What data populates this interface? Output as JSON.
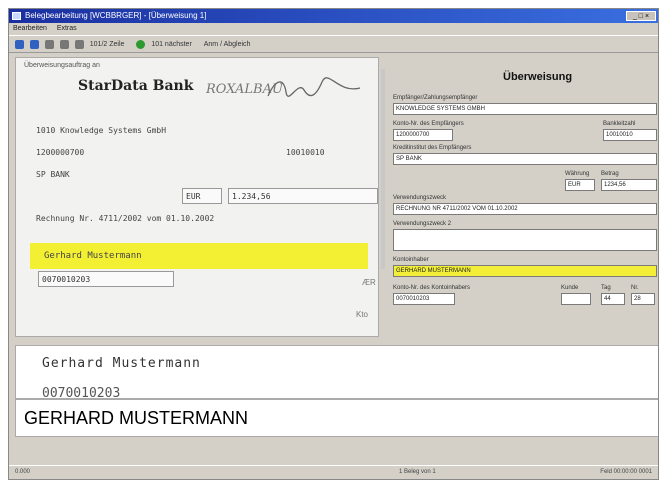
{
  "window": {
    "title": "Belegbearbeitung [WCBBRGER] - [Überweisung 1]"
  },
  "menu": {
    "items": [
      "Bearbeiten",
      "Extras"
    ]
  },
  "toolbar": {
    "items": [
      "101/2 Zeile",
      "101 nächster",
      "Anm / Abgleich"
    ]
  },
  "cheque": {
    "label": "Überweisungsauftrag an",
    "bank_name": "StarData Bank",
    "stamp": "ROXALBAU",
    "line1": "1010 Knowledge Systems GmbH",
    "account": "1200000700",
    "bank_code": "10010010",
    "bank_text": "SP BANK",
    "currency": "EUR",
    "amount": "1.234,56",
    "reference": "Rechnung Nr. 4711/2002 vom 01.10.2002",
    "payer_name": "Gerhard Mustermann",
    "payer_account": "0070010203",
    "side_icons": [
      "ÆR",
      "Kto"
    ]
  },
  "form": {
    "title": "Überweisung",
    "recipient_label": "Empfänger/Zahlungsempfänger",
    "recipient_value": "KNOWLEDGE SYSTEMS GMBH",
    "account_label": "Konto-Nr. des Empfängers",
    "account_value": "1200000700",
    "bank_code_label": "Bankleitzahl",
    "bank_code_value": "10010010",
    "bank_label": "Kreditinstitut des Empfängers",
    "bank_value": "SP BANK",
    "currency_label": "Währung",
    "currency_value": "EUR",
    "amount_label": "Betrag",
    "amount_value": "1234,56",
    "purpose_label": "Verwendungszweck",
    "purpose_value": "RECHNUNG NR 4711/2002 VOM 01.10.2002",
    "purpose2_label": "Verwendungszweck 2",
    "purpose2_value": "",
    "payer_label": "Kontoinhaber",
    "payer_value": "GERHARD MUSTERMANN",
    "payer_account_label": "Konto-Nr. des Kontoinhabers",
    "payer_account_value": "0070010203",
    "field_a_label": "Kunde",
    "field_a_value": "",
    "field_b_label": "Tag",
    "field_b_value": "44",
    "field_c_label": "Nr.",
    "field_c_value": "28"
  },
  "handwriting": {
    "line1": "Gerhard Mustermann",
    "line2": "0070010203"
  },
  "ocr": {
    "value": "GERHARD MUSTERMANN"
  },
  "status": {
    "left": "0.000",
    "mid": "1 Beleg von 1",
    "right": "Feld    00:00:00    0001"
  }
}
